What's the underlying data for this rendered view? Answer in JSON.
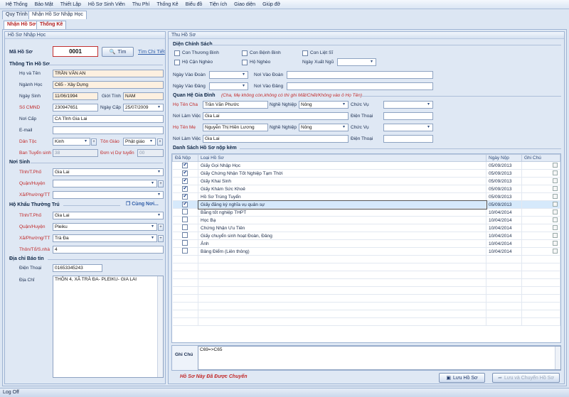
{
  "menu": [
    "Hệ Thống",
    "Bảo Mật",
    "Thiết Lập",
    "Hồ Sơ Sinh Viên",
    "Thu Phí",
    "Thống Kê",
    "Biểu đồ",
    "Tiện ích",
    "Giao diện",
    "Giúp đỡ"
  ],
  "tabs": [
    "Quy Trình",
    "Nhận Hồ Sơ Nhập Học"
  ],
  "subtabs": [
    "Nhận Hồ Sơ",
    "Thống Kê"
  ],
  "left": {
    "title": "Hồ Sơ Nhập Học",
    "ma_ho_so_label": "Mã Hồ Sơ",
    "ma_ho_so": "0001",
    "tim_btn": "Tìm",
    "tim_chi_tiet": "Tìm Chi Tiết",
    "sec_thong_tin": "Thông Tin Hồ Sơ",
    "ho_ten_label": "Họ và Tên",
    "ho_ten": "TRẦN VĂN AN",
    "nganh_hoc_label": "Ngành Học",
    "nganh_hoc": "C65 - Xây Dựng",
    "ngay_sinh_label": "Ngày Sinh",
    "ngay_sinh": "11/06/1994",
    "gioi_tinh_label": "Giới Tính",
    "gioi_tinh": "NAM",
    "cmnd_label": "Số CMND",
    "cmnd": "230947651",
    "ngay_cap_label": "Ngày Cấp",
    "ngay_cap": "25/07/2009",
    "noi_cap_label": "Nơi Cấp",
    "noi_cap": "CA Tỉnh Gia Lai",
    "email_label": "E-mail",
    "email": "",
    "dan_toc_label": "Dân Tộc",
    "dan_toc": "Kinh",
    "ton_giao_label": "Tôn Giáo",
    "ton_giao": "Phật giáo",
    "ban_tuyen_sinh_label": "Ban Tuyển sinh",
    "ban_tuyen_sinh": "38",
    "don_vi_label": "Đơn vị Dự tuyển",
    "don_vi": "00",
    "sec_noi_sinh": "Nơi Sinh",
    "tinh_label": "Tỉnh/T.Phố",
    "noi_sinh_tinh": "Gia Lai",
    "quan_label": "Quận/Huyện",
    "noi_sinh_quan": "",
    "xa_label": "Xã/Phường/TT",
    "noi_sinh_xa": "",
    "sec_ho_khau": "Hộ Khẩu Thường Trú",
    "cung_noi": "Cùng Nơi...",
    "hk_tinh": "Gia Lai",
    "hk_quan": "Pleiku",
    "hk_xa": "Trà Đa",
    "thon_label": "Thôn/Tổ/S.nhà",
    "hk_thon": "4",
    "sec_dia_chi": "Địa chỉ Báo tin",
    "dien_thoai_label": "Điện Thoại",
    "dien_thoai": "01653345243",
    "dia_chi_label": "Địa Chỉ",
    "dia_chi": "THÔN 4, XÃ TRÀ ĐA- PLEIKU- GIA LAI"
  },
  "right": {
    "title": "Thu Hồ Sơ",
    "sec_dien_cs": "Diện Chính Sách",
    "cs": [
      "Con Thương Binh",
      "Con Bệnh Binh",
      "Con Liệt Sĩ",
      "Hộ Cận Nghèo",
      "Hộ Nghèo"
    ],
    "ngay_xuat_ngu": "Ngày Xuất Ngũ",
    "ngay_vao_doan": "Ngày Vào Đoàn",
    "noi_vao_doan": "Nơi Vào Đoàn",
    "ngay_vao_dang": "Ngày Vào Đảng",
    "noi_vao_dang": "Nơi Vào Đảng",
    "sec_gia_dinh": "Quan Hệ Gia Đình",
    "gia_dinh_note": "(Cha, Mẹ không còn,không có thì ghi Mất/Chết/Không vào ô Họ Tên)",
    "ho_ten_cha_label": "Họ Tên Cha",
    "ho_ten_cha": "Trần Văn Phước",
    "nghe_nghiep_label": "Nghề Nghiệp",
    "nghe_cha": "Nông",
    "chuc_vu_label": "Chức Vụ",
    "noi_lam_viec_label": "Nơi Làm Việc",
    "noi_lv_cha": "Gia Lai",
    "dien_thoai_label": "Điện Thoại",
    "ho_ten_me_label": "Họ Tên Mẹ",
    "ho_ten_me": "Nguyễn Thị Hiền Lương",
    "nghe_me": "Nông",
    "noi_lv_me": "Gia Lai",
    "sec_danh_sach": "Danh Sách Hồ Sơ nộp kèm",
    "cols": [
      "Đã Nộp",
      "Loại Hồ Sơ",
      "Ngày Nộp",
      "Ghi Chú"
    ],
    "rows": [
      {
        "checked": "✔",
        "name": "Giấy Gọi Nhập Học",
        "date": "05/09/2013"
      },
      {
        "checked": "✔",
        "name": "Giấy Chứng Nhận Tốt Nghiệp Tạm Thời",
        "date": "05/09/2013"
      },
      {
        "checked": "✔",
        "name": "Giấy Khai Sinh",
        "date": "05/09/2013"
      },
      {
        "checked": "✔",
        "name": "Giấy Khám Sức Khoẻ",
        "date": "05/09/2013"
      },
      {
        "checked": "✔",
        "name": "Hồ Sơ Trúng Tuyển",
        "date": "05/09/2013"
      },
      {
        "checked": "✔",
        "name": "Giấy đăng ký nghĩa vụ quân sự",
        "date": "05/09/2013"
      },
      {
        "checked": "",
        "name": "Bằng tốt nghiệp THPT",
        "date": "10/04/2014"
      },
      {
        "checked": "",
        "name": "Học Bạ",
        "date": "10/04/2014"
      },
      {
        "checked": "",
        "name": "Chứng Nhận Ưu Tiên",
        "date": "10/04/2014"
      },
      {
        "checked": "",
        "name": "Giấy chuyển sinh hoạt Đoàn, Đảng",
        "date": "10/04/2014"
      },
      {
        "checked": "",
        "name": "Ảnh",
        "date": "10/04/2014"
      },
      {
        "checked": "",
        "name": "Bảng Điểm (Liên thông)",
        "date": "10/04/2014"
      }
    ],
    "ghi_chu_label": "Ghi Chú",
    "ghi_chu": "C69=>C65",
    "status_note": "Hồ Sơ Này Đã Được Chuyển",
    "luu_btn": "Lưu Hồ Sơ",
    "luu_chuyen_btn": "Lưu và Chuyển Hồ Sơ"
  },
  "statusbar": "Log Off"
}
